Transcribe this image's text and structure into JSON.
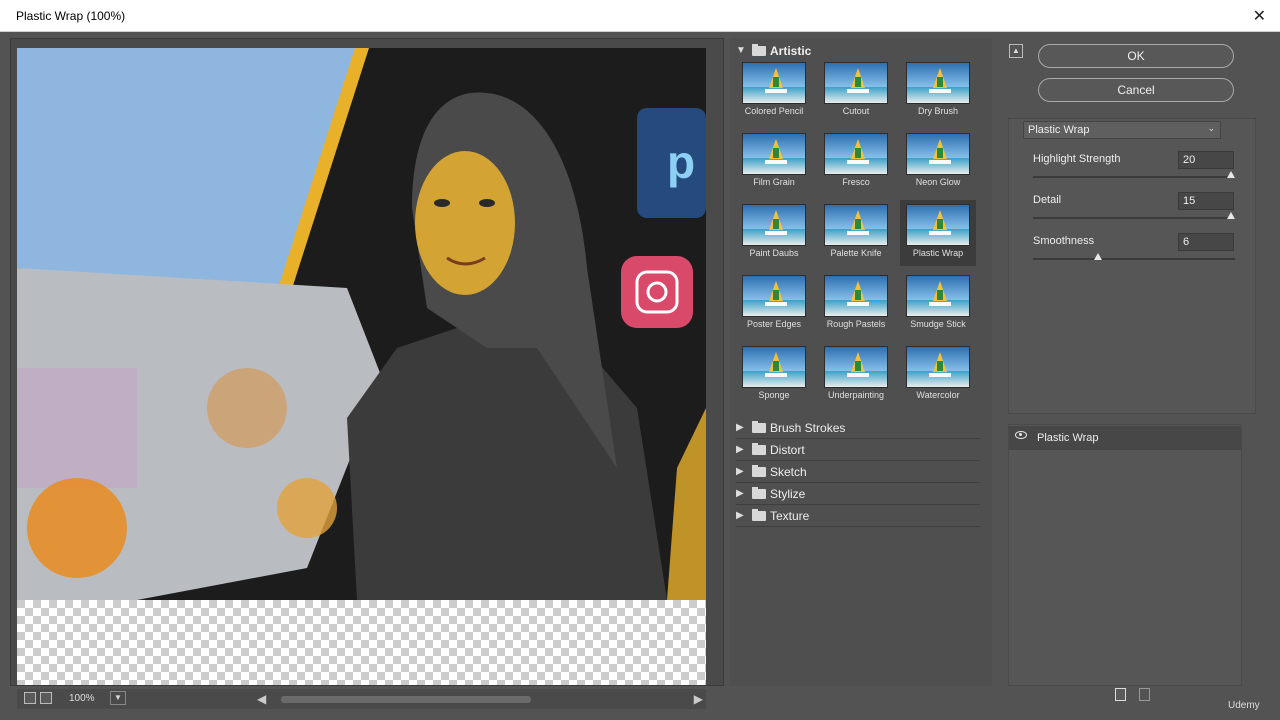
{
  "window": {
    "title": "Plastic Wrap (100%)"
  },
  "preview": {
    "zoom": "100%"
  },
  "gallery": {
    "open_category": "Artistic",
    "filters": [
      {
        "label": "Colored Pencil",
        "name": "filter-colored-pencil"
      },
      {
        "label": "Cutout",
        "name": "filter-cutout"
      },
      {
        "label": "Dry Brush",
        "name": "filter-dry-brush"
      },
      {
        "label": "Film Grain",
        "name": "filter-film-grain"
      },
      {
        "label": "Fresco",
        "name": "filter-fresco"
      },
      {
        "label": "Neon Glow",
        "name": "filter-neon-glow"
      },
      {
        "label": "Paint Daubs",
        "name": "filter-paint-daubs"
      },
      {
        "label": "Palette Knife",
        "name": "filter-palette-knife"
      },
      {
        "label": "Plastic Wrap",
        "name": "filter-plastic-wrap",
        "selected": true
      },
      {
        "label": "Poster Edges",
        "name": "filter-poster-edges"
      },
      {
        "label": "Rough Pastels",
        "name": "filter-rough-pastels"
      },
      {
        "label": "Smudge Stick",
        "name": "filter-smudge-stick"
      },
      {
        "label": "Sponge",
        "name": "filter-sponge"
      },
      {
        "label": "Underpainting",
        "name": "filter-underpainting"
      },
      {
        "label": "Watercolor",
        "name": "filter-watercolor"
      }
    ],
    "categories": [
      "Brush Strokes",
      "Distort",
      "Sketch",
      "Stylize",
      "Texture"
    ]
  },
  "buttons": {
    "ok": "OK",
    "cancel": "Cancel"
  },
  "settings": {
    "selected_filter": "Plastic Wrap",
    "params": [
      {
        "label": "Highlight Strength",
        "value": "20",
        "level": 1.0
      },
      {
        "label": "Detail",
        "value": "15",
        "level": 1.0
      },
      {
        "label": "Smoothness",
        "value": "6",
        "level": 0.33
      }
    ]
  },
  "layers": {
    "items": [
      {
        "name": "Plastic Wrap"
      }
    ]
  },
  "watermark": {
    "brand": "Udemy"
  },
  "colors": {
    "panel_bg": "#535353",
    "selected_bg": "#3c3c3c",
    "highlight": "#f2c23a"
  }
}
